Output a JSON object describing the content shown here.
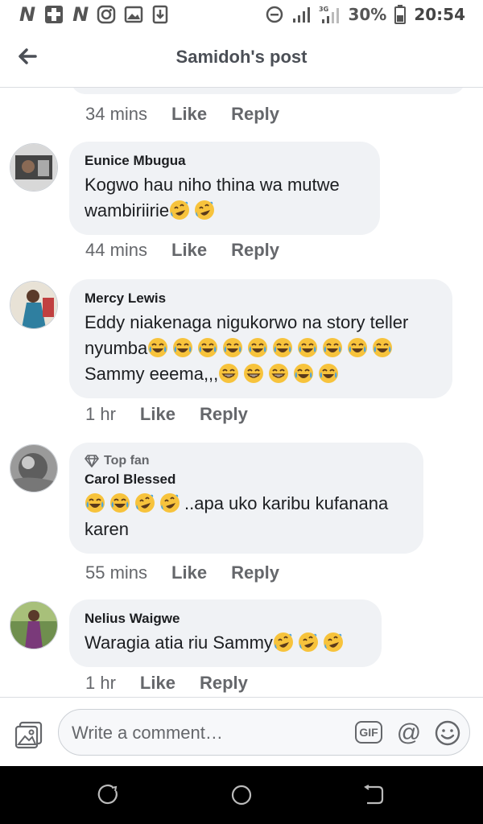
{
  "status_bar": {
    "battery": "30%",
    "time": "20:54",
    "network": "3G"
  },
  "header": {
    "title": "Samidoh's post"
  },
  "prev_comment_meta": {
    "time": "34 mins",
    "like": "Like",
    "reply": "Reply"
  },
  "comments": [
    {
      "author": "Eunice Mbugua",
      "text": "Kogwo hau niho thina wa mutwe wambiriirie",
      "emojis": [
        "rofl",
        "rofl"
      ],
      "time": "44 mins",
      "like": "Like",
      "reply": "Reply"
    },
    {
      "author": "Mercy Lewis",
      "text_line1": "Eddy niakenaga nigukorwo na story teller",
      "text_line2": "nyumba",
      "text_line3": "Sammy eeema,,,",
      "emojis_line2": [
        "joy",
        "joy",
        "joy",
        "joy",
        "joy",
        "joy",
        "joy",
        "joy",
        "joy",
        "joy"
      ],
      "emojis_line3": [
        "grin",
        "grin",
        "grin",
        "joy",
        "joy"
      ],
      "time": "1 hr",
      "like": "Like",
      "reply": "Reply"
    },
    {
      "badge": "Top fan",
      "author": "Carol Blessed",
      "text": "..apa uko karibu kufanana karen",
      "emojis": [
        "joy",
        "joy",
        "rofl",
        "rofl"
      ],
      "time": "55 mins",
      "like": "Like",
      "reply": "Reply"
    },
    {
      "author": "Nelius Waigwe",
      "text": "Waragia atia riu Sammy",
      "emojis": [
        "rofl",
        "rofl",
        "rofl"
      ],
      "time": "1 hr",
      "like": "Like",
      "reply": "Reply"
    }
  ],
  "composer": {
    "placeholder": "Write a comment…",
    "gif_label": "GIF",
    "at_label": "@"
  },
  "icons": {
    "back": "arrow-left-icon",
    "photo": "photo-icon",
    "emoji": "smiley-icon",
    "nav_recent": "recent-apps-icon",
    "nav_home": "home-icon",
    "nav_back": "back-icon"
  },
  "colors": {
    "bubble": "#f0f2f5",
    "muted_text": "#65676b",
    "emoji_face": "#f7c33c"
  }
}
